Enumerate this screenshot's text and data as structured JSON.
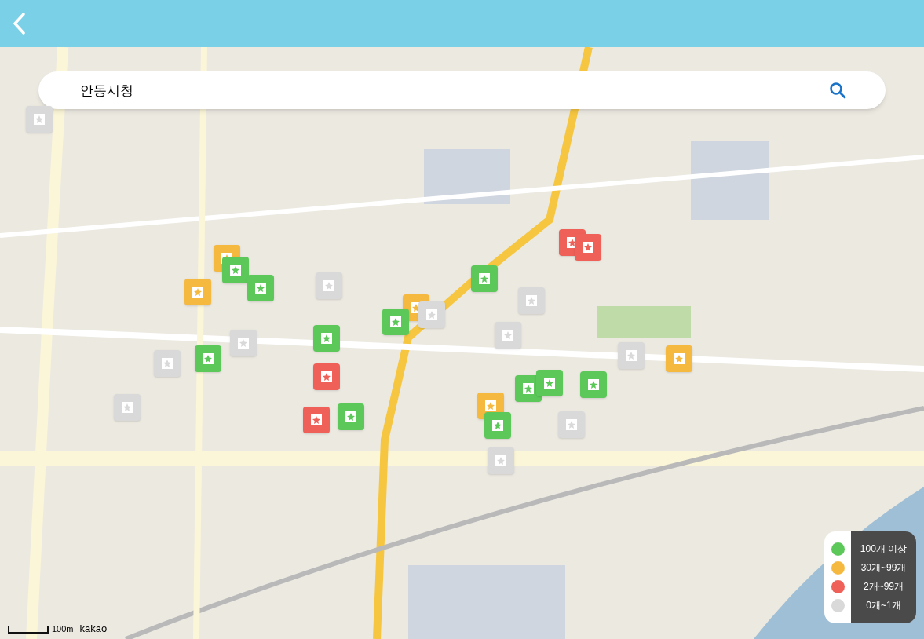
{
  "search": {
    "value": "안동시청"
  },
  "legend": [
    {
      "label": "100개 이상",
      "color": "#5cc85a"
    },
    {
      "label": "30개~99개",
      "color": "#f5b940"
    },
    {
      "label": "2개~99개",
      "color": "#ef6158"
    },
    {
      "label": "0개~1개",
      "color": "#d9d9d9"
    }
  ],
  "markers": [
    {
      "color": "#d9d9d9"
    },
    {
      "color": "#f5b940"
    },
    {
      "color": "#5cc85a"
    },
    {
      "color": "#5cc85a"
    },
    {
      "color": "#f5b940"
    },
    {
      "color": "#d9d9d9"
    },
    {
      "color": "#f5b940"
    },
    {
      "color": "#5cc85a"
    },
    {
      "color": "#d9d9d9"
    },
    {
      "color": "#5cc85a"
    },
    {
      "color": "#d9d9d9"
    },
    {
      "color": "#ef6158"
    },
    {
      "color": "#ef6158"
    },
    {
      "color": "#d9d9d9"
    },
    {
      "color": "#5cc85a"
    },
    {
      "color": "#d9d9d9"
    },
    {
      "color": "#d9d9d9"
    },
    {
      "color": "#5cc85a"
    },
    {
      "color": "#ef6158"
    },
    {
      "color": "#d9d9d9"
    },
    {
      "color": "#f5b940"
    },
    {
      "color": "#5cc85a"
    },
    {
      "color": "#5cc85a"
    },
    {
      "color": "#5cc85a"
    },
    {
      "color": "#f5b940"
    },
    {
      "color": "#5cc85a"
    },
    {
      "color": "#ef6158"
    },
    {
      "color": "#5cc85a"
    },
    {
      "color": "#d9d9d9"
    },
    {
      "color": "#d9d9d9"
    },
    {
      "color": "#d9d9d9"
    }
  ],
  "scale": "100m",
  "attribution": "kakao"
}
